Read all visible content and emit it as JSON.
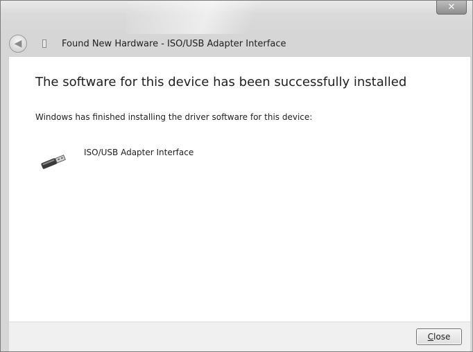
{
  "window": {
    "close_glyph": "✕"
  },
  "header": {
    "back_glyph": "◀",
    "title": "Found New Hardware - ISO/USB Adapter Interface"
  },
  "content": {
    "heading": "The software for this device has been successfully installed",
    "description": "Windows has finished installing the driver software for this device:",
    "device": {
      "name": "ISO/USB Adapter Interface",
      "icon": "usb-connector-icon"
    }
  },
  "footer": {
    "close_button": {
      "mnemonic": "C",
      "rest": "lose"
    }
  }
}
